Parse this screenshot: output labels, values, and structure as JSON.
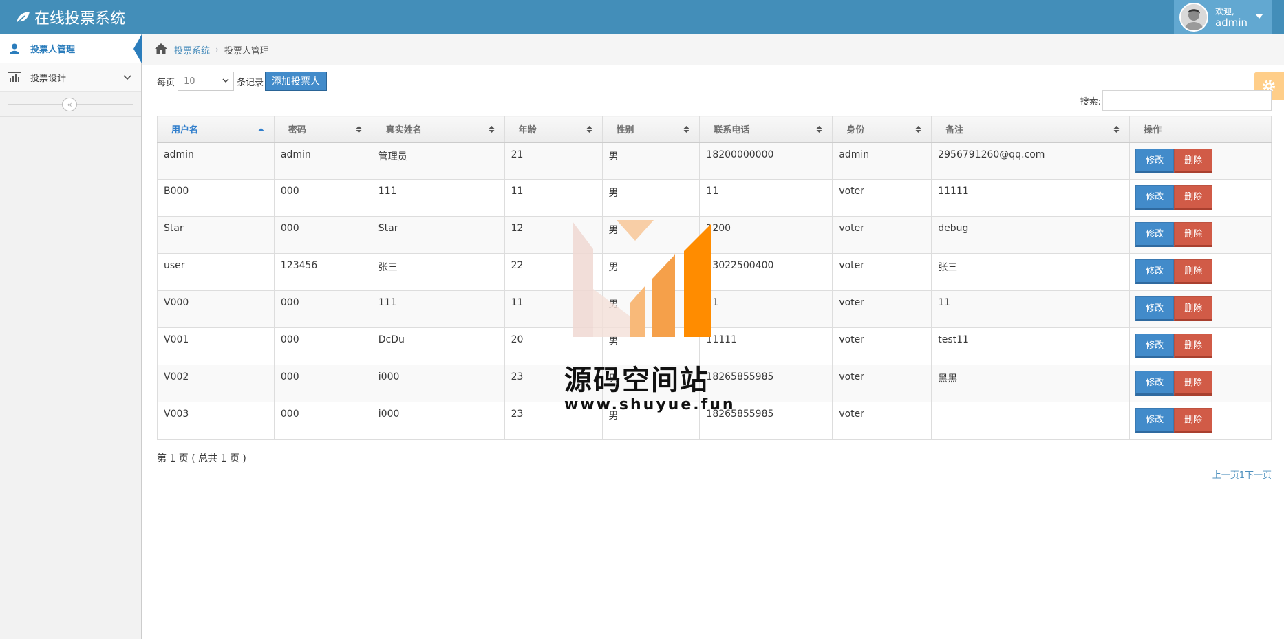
{
  "app": {
    "title": "在线投票系统"
  },
  "user": {
    "welcome": "欢迎,",
    "name": "admin"
  },
  "sidebar": {
    "items": [
      {
        "label": "投票人管理",
        "icon": "user-icon",
        "active": true
      },
      {
        "label": "投票设计",
        "icon": "bar-chart-icon",
        "active": false
      }
    ],
    "collapse_icon": "double-chevron-left-icon"
  },
  "breadcrumb": {
    "home": "投票系统",
    "current": "投票人管理"
  },
  "toolbar": {
    "per_page_label": "每页",
    "per_page_value": "10",
    "records_label": "条记录",
    "add_button": "添加投票人",
    "search_label": "搜索:"
  },
  "table": {
    "columns": [
      "用户名",
      "密码",
      "真实姓名",
      "年龄",
      "性别",
      "联系电话",
      "身份",
      "备注",
      "操作"
    ],
    "edit_label": "修改",
    "delete_label": "删除",
    "rows": [
      [
        "admin",
        "admin",
        "管理员",
        "21",
        "男",
        "18200000000",
        "admin",
        "2956791260@qq.com"
      ],
      [
        "B000",
        "000",
        "111",
        "11",
        "男",
        "11",
        "voter",
        "11111"
      ],
      [
        "Star",
        "000",
        "Star",
        "12",
        "男",
        "1200",
        "voter",
        "debug"
      ],
      [
        "user",
        "123456",
        "张三",
        "22",
        "男",
        "13022500400",
        "voter",
        "张三"
      ],
      [
        "V000",
        "000",
        "111",
        "11",
        "男",
        "11",
        "voter",
        "11"
      ],
      [
        "V001",
        "000",
        "DcDu",
        "20",
        "男",
        "11111",
        "voter",
        "test11"
      ],
      [
        "V002",
        "000",
        "i000",
        "23",
        "男",
        "18265855985",
        "voter",
        "黑黑"
      ],
      [
        "V003",
        "000",
        "i000",
        "23",
        "男",
        "18265855985",
        "voter",
        ""
      ]
    ]
  },
  "pagination": {
    "info": "第 1 页 ( 总共 1 页 )",
    "links": "上一页1下一页"
  },
  "watermark": {
    "title": "源码空间站",
    "url": "www.shuyue.fun"
  },
  "colors": {
    "navbar": "#438eb9",
    "primary": "#428bca",
    "danger": "#d15b47",
    "accent": "#ff8c00"
  }
}
